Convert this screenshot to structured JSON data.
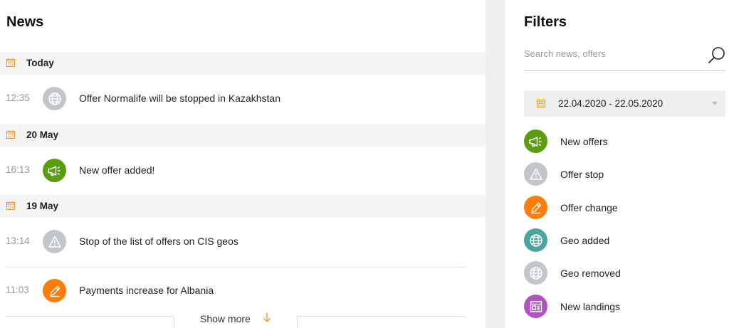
{
  "news": {
    "title": "News",
    "groups": [
      {
        "day": "Today",
        "items": [
          {
            "time": "12:35",
            "icon": "globe-icon",
            "color": "#c2c6cb",
            "text": "Offer Normalife will be stopped in Kazakhstan"
          }
        ]
      },
      {
        "day": "20 May",
        "items": [
          {
            "time": "16:13",
            "icon": "megaphone-icon",
            "color": "#5a9e0f",
            "text": "New offer added!"
          }
        ]
      },
      {
        "day": "19 May",
        "items": [
          {
            "time": "13:14",
            "icon": "warning-icon",
            "color": "#c2c6cb",
            "text": "Stop of the list of offers on CIS geos"
          },
          {
            "time": "11:03",
            "icon": "pencil-icon",
            "color": "#fb7d0b",
            "text": "Payments increase for Albania"
          }
        ]
      }
    ],
    "show_more": "Show more"
  },
  "filters": {
    "title": "Filters",
    "search_placeholder": "Search news, offers",
    "date_range": "22.04.2020 - 22.05.2020",
    "items": [
      {
        "label": "New offers",
        "icon": "megaphone-icon",
        "color": "#5a9e0f"
      },
      {
        "label": "Offer stop",
        "icon": "warning-icon",
        "color": "#c2c6cb"
      },
      {
        "label": "Offer change",
        "icon": "pencil-icon",
        "color": "#fb7d0b"
      },
      {
        "label": "Geo added",
        "icon": "globe-icon",
        "color": "#4aa59f"
      },
      {
        "label": "Geo removed",
        "icon": "globe-icon",
        "color": "#c2c6cb"
      },
      {
        "label": "New landings",
        "icon": "landing-page-icon",
        "color": "#b053bf"
      }
    ]
  },
  "colors": {
    "accent": "#f7941d",
    "panel_gray": "#f5f5f5",
    "gap_gray": "#efefef"
  }
}
